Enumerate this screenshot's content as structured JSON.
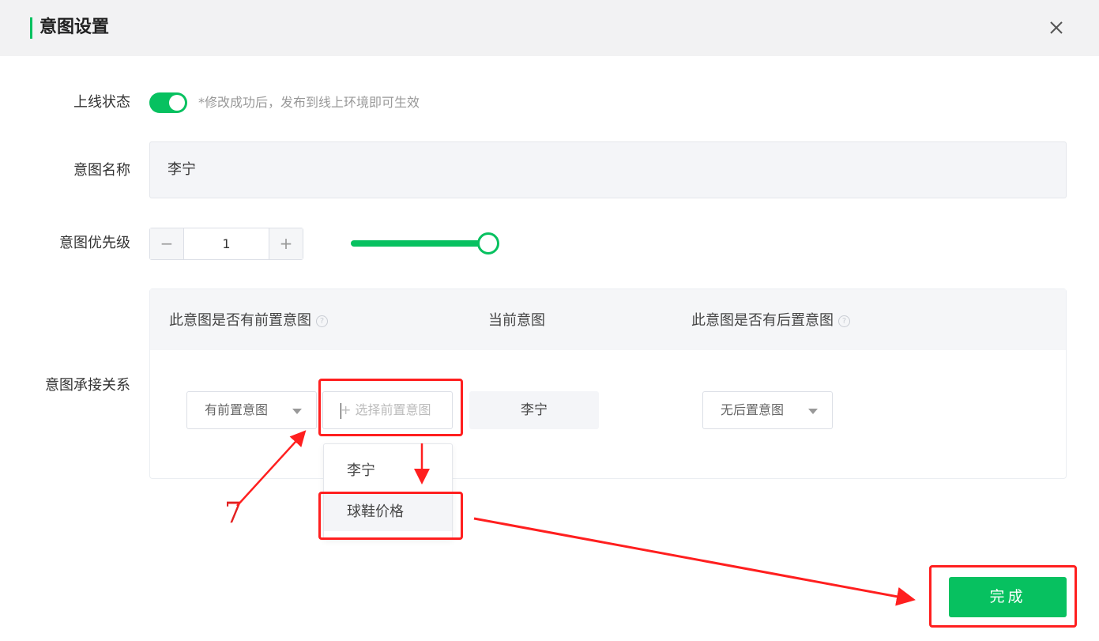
{
  "dialog": {
    "title": "意图设置"
  },
  "status": {
    "label": "上线状态",
    "enabled": true,
    "hint": "*修改成功后，发布到线上环境即可生效"
  },
  "intent_name": {
    "label": "意图名称",
    "value": "李宁"
  },
  "priority": {
    "label": "意图优先级",
    "minus": "−",
    "value": "1",
    "plus": "+",
    "slider_level": 1.0
  },
  "relation": {
    "label": "意图承接关系",
    "columns": {
      "pre": "此意图是否有前置意图",
      "current": "当前意图",
      "post": "此意图是否有后置意图"
    },
    "help_icon": "?",
    "pre_select": "有前置意图",
    "pre_input_placeholder": "+ 选择前置意图",
    "current_value": "李宁",
    "post_select": "无后置意图",
    "dropdown_options": [
      "李宁",
      "球鞋价格"
    ]
  },
  "actions": {
    "done": "完成"
  },
  "annotation": {
    "step_number": "7",
    "color": "#ff1f1f"
  },
  "colors": {
    "accent": "#07c160"
  }
}
